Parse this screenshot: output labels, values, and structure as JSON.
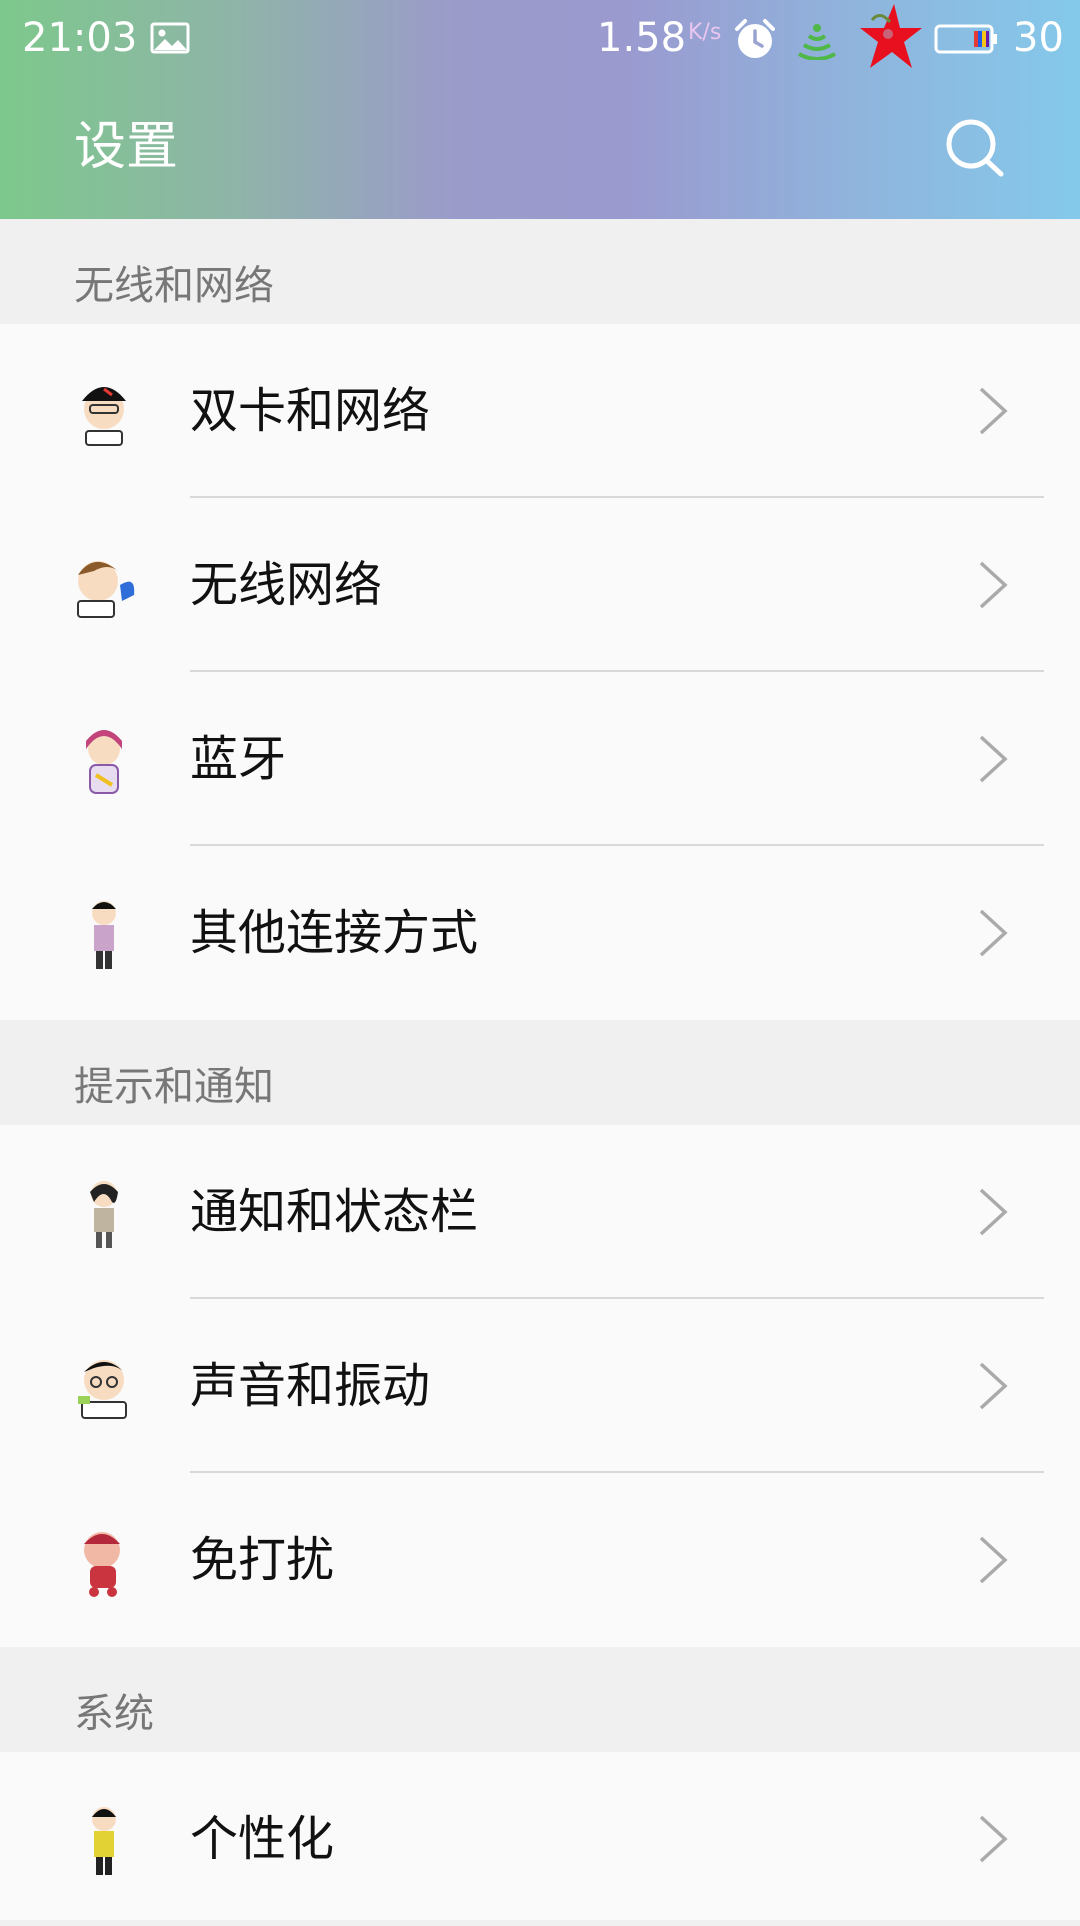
{
  "status_bar": {
    "time": "21:03",
    "net_speed": "1.58",
    "net_speed_unit": "K/s",
    "battery": "30",
    "icons": [
      "image-icon",
      "alarm-icon",
      "signal-icon",
      "star-icon",
      "battery-icon"
    ]
  },
  "header": {
    "title": "设置",
    "search_icon": "search-icon"
  },
  "sections": [
    {
      "title": "无线和网络",
      "items": [
        {
          "label": "双卡和网络"
        },
        {
          "label": "无线网络"
        },
        {
          "label": "蓝牙"
        },
        {
          "label": "其他连接方式"
        }
      ]
    },
    {
      "title": "提示和通知",
      "items": [
        {
          "label": "通知和状态栏"
        },
        {
          "label": "声音和振动"
        },
        {
          "label": "免打扰"
        }
      ]
    },
    {
      "title": "系统",
      "items": [
        {
          "label": "个性化"
        }
      ]
    }
  ],
  "colors": {
    "gradient_left": "#7dc88c",
    "gradient_mid": "#9a9acf",
    "gradient_right": "#84c9ea",
    "section_bg": "#f0f0f0",
    "row_bg": "#fafafa"
  }
}
